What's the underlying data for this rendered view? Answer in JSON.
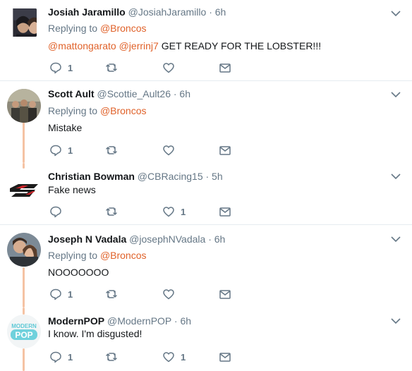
{
  "tweets": [
    {
      "name": "Josiah Jaramillo",
      "handle": "@JosiahJaramillo",
      "time": "· 6h",
      "replying_prefix": "Replying to",
      "replying_to": "@Broncos",
      "mentions": "@mattongarato @jerrinj7",
      "text": "GET READY FOR THE LOBSTER!!!",
      "replies": "1",
      "retweets": "",
      "likes": "",
      "avatar_icon": "couple-selfie-avatar"
    },
    {
      "name": "Scott Ault",
      "handle": "@Scottie_Ault26",
      "time": "· 6h",
      "replying_prefix": "Replying to",
      "replying_to": "@Broncos",
      "text": "Mistake",
      "replies": "1",
      "retweets": "",
      "likes": "",
      "avatar_icon": "group-photo-avatar"
    },
    {
      "name": "Christian Bowman",
      "handle": "@CBRacing15",
      "time": "· 5h",
      "text": "Fake news",
      "replies": "",
      "retweets": "",
      "likes": "1",
      "avatar_icon": "racing-logo-avatar"
    },
    {
      "name": "Joseph N Vadala",
      "handle": "@josephNVadala",
      "time": "· 6h",
      "replying_prefix": "Replying to",
      "replying_to": "@Broncos",
      "text": "NOOOOOOO",
      "replies": "1",
      "retweets": "",
      "likes": "",
      "avatar_icon": "couple-photo-avatar"
    },
    {
      "name": "ModernPOP",
      "handle": "@ModernPOP",
      "time": "· 6h",
      "text": "I know. I'm disgusted!",
      "replies": "1",
      "retweets": "",
      "likes": "1",
      "avatar_icon": "modernpop-logo-avatar",
      "avatar_logo_top": "MODERN",
      "avatar_logo_bottom": "POP"
    }
  ],
  "colors": {
    "link": "#e0622a",
    "muted": "#657786",
    "thread_line": "#f5c3a4",
    "divider": "#e6ecf0"
  }
}
